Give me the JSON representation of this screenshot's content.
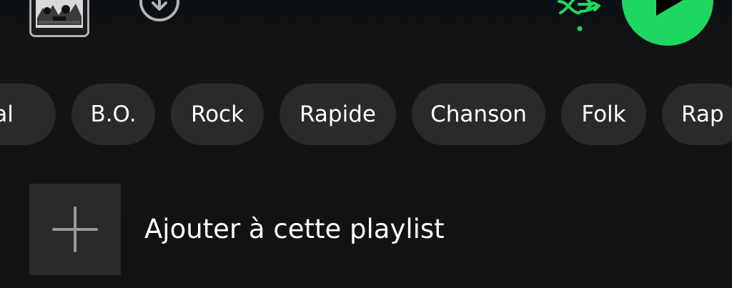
{
  "header": {
    "cover_icon": "album-cover-thumbnail",
    "download_icon": "download-circle-icon",
    "shuffle_icon": "smart-shuffle-icon",
    "play_icon": "play-icon",
    "accent_color": "#1ed760"
  },
  "genre_chips": [
    {
      "label": "etal"
    },
    {
      "label": "B.O."
    },
    {
      "label": "Rock"
    },
    {
      "label": "Rapide"
    },
    {
      "label": "Chanson"
    },
    {
      "label": "Folk"
    },
    {
      "label": "Rap"
    }
  ],
  "add_to_playlist": {
    "icon": "plus-icon",
    "label": "Ajouter à cette playlist"
  }
}
